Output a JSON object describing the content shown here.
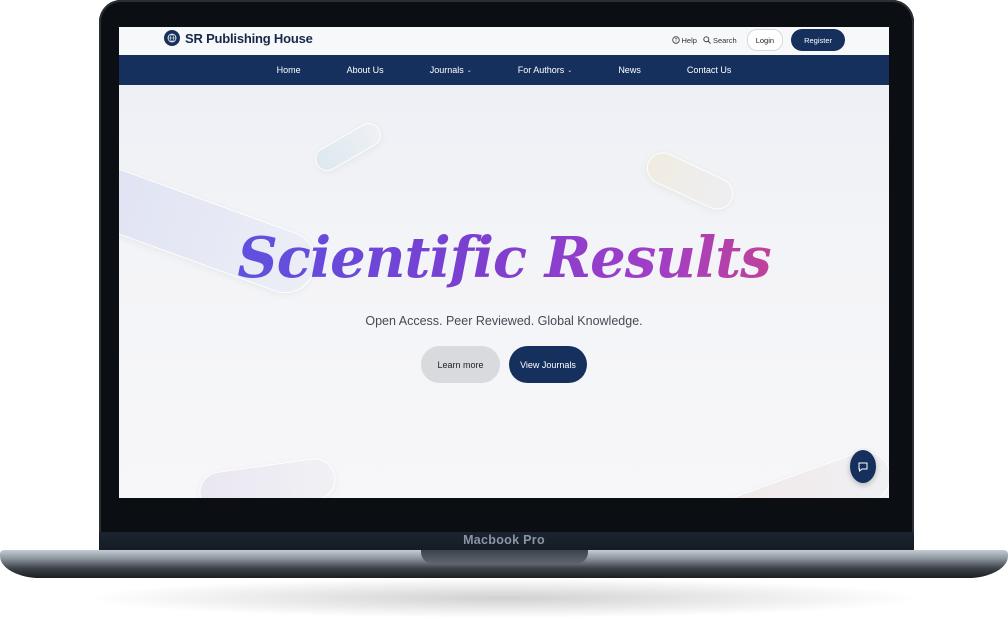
{
  "device": {
    "label": "Macbook Pro"
  },
  "site": {
    "brand": {
      "name": "SR Publishing House",
      "logo_icon": "globe-icon"
    },
    "utility": {
      "help": "Help",
      "search": "Search",
      "login": "Login",
      "register": "Register"
    },
    "nav": [
      {
        "label": "Home",
        "dropdown": false
      },
      {
        "label": "About Us",
        "dropdown": false
      },
      {
        "label": "Journals",
        "dropdown": true
      },
      {
        "label": "For Authors",
        "dropdown": true
      },
      {
        "label": "News",
        "dropdown": false
      },
      {
        "label": "Contact Us",
        "dropdown": false
      }
    ],
    "hero": {
      "title": "Scientific Results",
      "subtitle": "Open Access. Peer Reviewed. Global Knowledge.",
      "learn_more": "Learn more",
      "view_journals": "View Journals"
    },
    "chat": {
      "icon": "chat-icon"
    }
  },
  "colors": {
    "primary": "#16305e",
    "title_gradient": [
      "#4f5be8",
      "#7a3fd1",
      "#a13ec6",
      "#e0466a"
    ],
    "secondary_button": "#d9dadd"
  }
}
